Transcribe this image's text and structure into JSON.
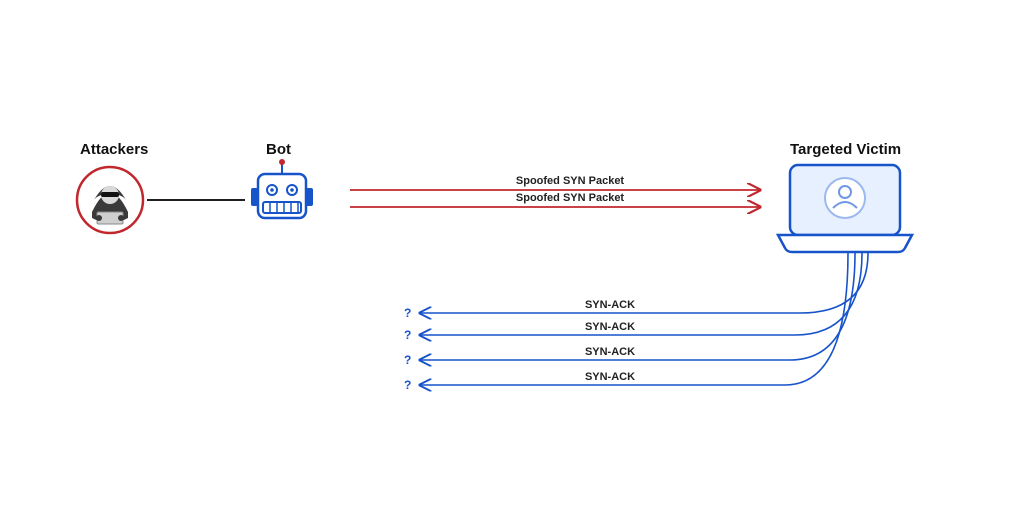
{
  "colors": {
    "red": "#c1272d",
    "blue": "#1753c9",
    "lightblue": "#e6f0ff",
    "gray": "#444444",
    "black": "#000000"
  },
  "labels": {
    "attackers": "Attackers",
    "bot": "Bot",
    "victim": "Targeted Victim"
  },
  "arrows": {
    "spoof1": "Spoofed SYN Packet",
    "spoof2": "Spoofed SYN Packet",
    "synack1": "SYN-ACK",
    "synack2": "SYN-ACK",
    "synack3": "SYN-ACK",
    "synack4": "SYN-ACK"
  },
  "qmark": "?"
}
